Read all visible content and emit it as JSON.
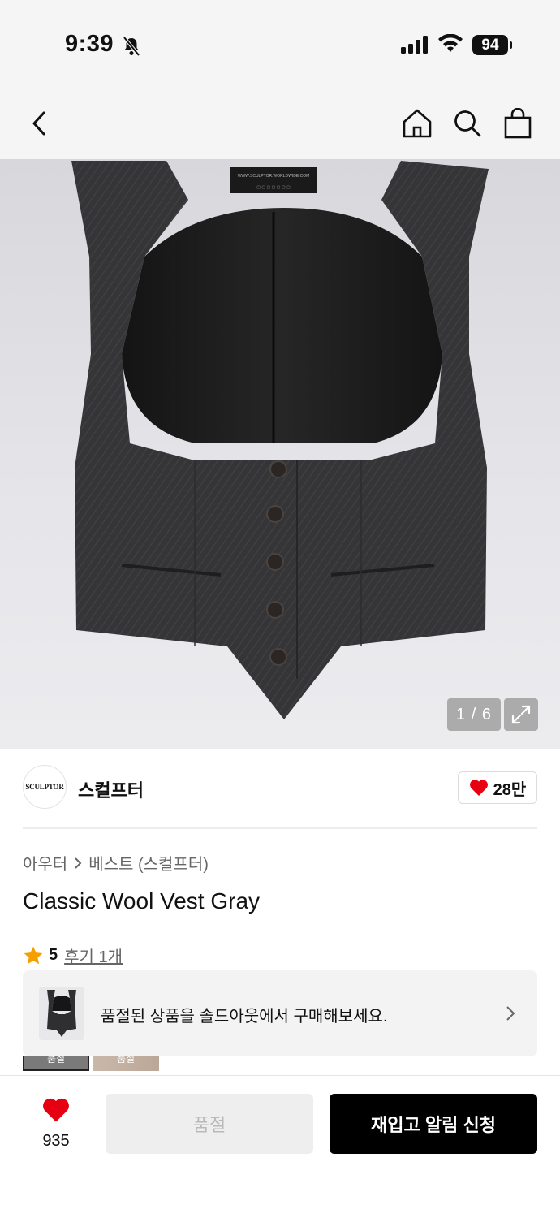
{
  "status_bar": {
    "time": "9:39",
    "battery": "94"
  },
  "product_image": {
    "counter": "1 / 6",
    "tag_text": "WWW.SCULPTOR.WORLDWIDE.COM"
  },
  "brand": {
    "logo_text": "SCULPTOR",
    "name": "스컬프터",
    "likes": "28만"
  },
  "breadcrumb": {
    "category": "아우터",
    "subcategory": "베스트 (스컬프터)"
  },
  "product": {
    "title": "Classic Wool Vest Gray",
    "rating": "5",
    "reviews": "후기 1개"
  },
  "soldout_banner": {
    "text": "품절된 상품을 솔드아웃에서 구매해보세요."
  },
  "thumbnails": [
    {
      "label": "품절"
    },
    {
      "label": "품절"
    }
  ],
  "bottom_bar": {
    "wish_count": "935",
    "soldout_label": "품절",
    "restock_label": "재입고 알림 신청"
  },
  "colors": {
    "accent": "#e60012",
    "rating_star": "#f5a000",
    "primary_button": "#000000"
  }
}
